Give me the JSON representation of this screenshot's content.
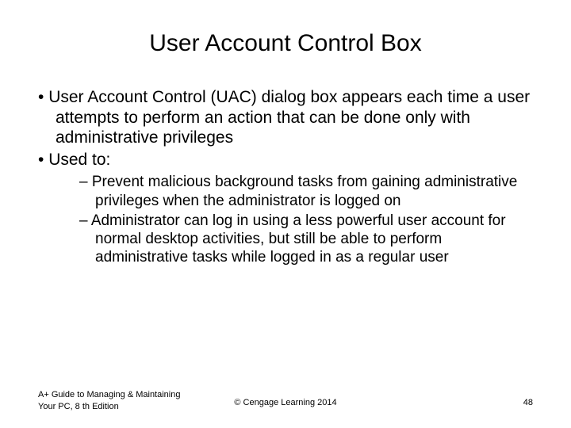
{
  "title": "User Account Control Box",
  "bullets": [
    {
      "text": "User Account Control (UAC) dialog box appears each time a user attempts to perform an action that can be done only with administrative privileges"
    },
    {
      "text": "Used to:",
      "subs": [
        "Prevent malicious background tasks from gaining administrative privileges when the administrator is logged on",
        "Administrator can log in using a less powerful user account for normal desktop activities, but still be able to perform administrative tasks while logged in as a regular user"
      ]
    }
  ],
  "footer": {
    "left": "A+ Guide to Managing & Maintaining Your PC, 8 th Edition",
    "center": "© Cengage Learning  2014",
    "right": "48"
  }
}
